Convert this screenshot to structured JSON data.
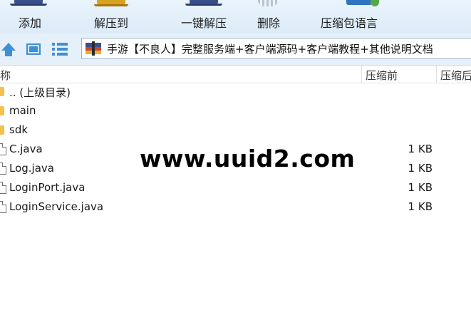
{
  "toolbar": {
    "items": [
      {
        "label": "添加",
        "icon": "add-archive-icon"
      },
      {
        "label": "解压到",
        "icon": "extract-to-icon"
      },
      {
        "label": "一键解压",
        "icon": "one-click-extract-icon"
      },
      {
        "label": "删除",
        "icon": "delete-icon"
      },
      {
        "label": "压缩包语言",
        "icon": "archive-language-icon"
      }
    ]
  },
  "navbar": {
    "path": "手游【不良人】完整服务端+客户端源码+客户端教程+其他说明文档"
  },
  "columns": {
    "name": "名称",
    "compressed_size": "压缩前",
    "packed_size": "压缩后"
  },
  "files": [
    {
      "name": ".. (上级目录)",
      "type": "folder",
      "size": ""
    },
    {
      "name": "main",
      "type": "folder",
      "size": ""
    },
    {
      "name": "sdk",
      "type": "folder",
      "size": ""
    },
    {
      "name": "C.java",
      "type": "file",
      "size": "1 KB"
    },
    {
      "name": "Log.java",
      "type": "file",
      "size": "1 KB"
    },
    {
      "name": "LoginPort.java",
      "type": "file",
      "size": "1 KB"
    },
    {
      "name": "LoginService.java",
      "type": "file",
      "size": "1 KB"
    }
  ],
  "watermark": "www.uuid2.com",
  "colors": {
    "toolbar_bg": "#dcebf8",
    "nav_accent": "#3f8fd6",
    "folder": "#f2c14e"
  }
}
